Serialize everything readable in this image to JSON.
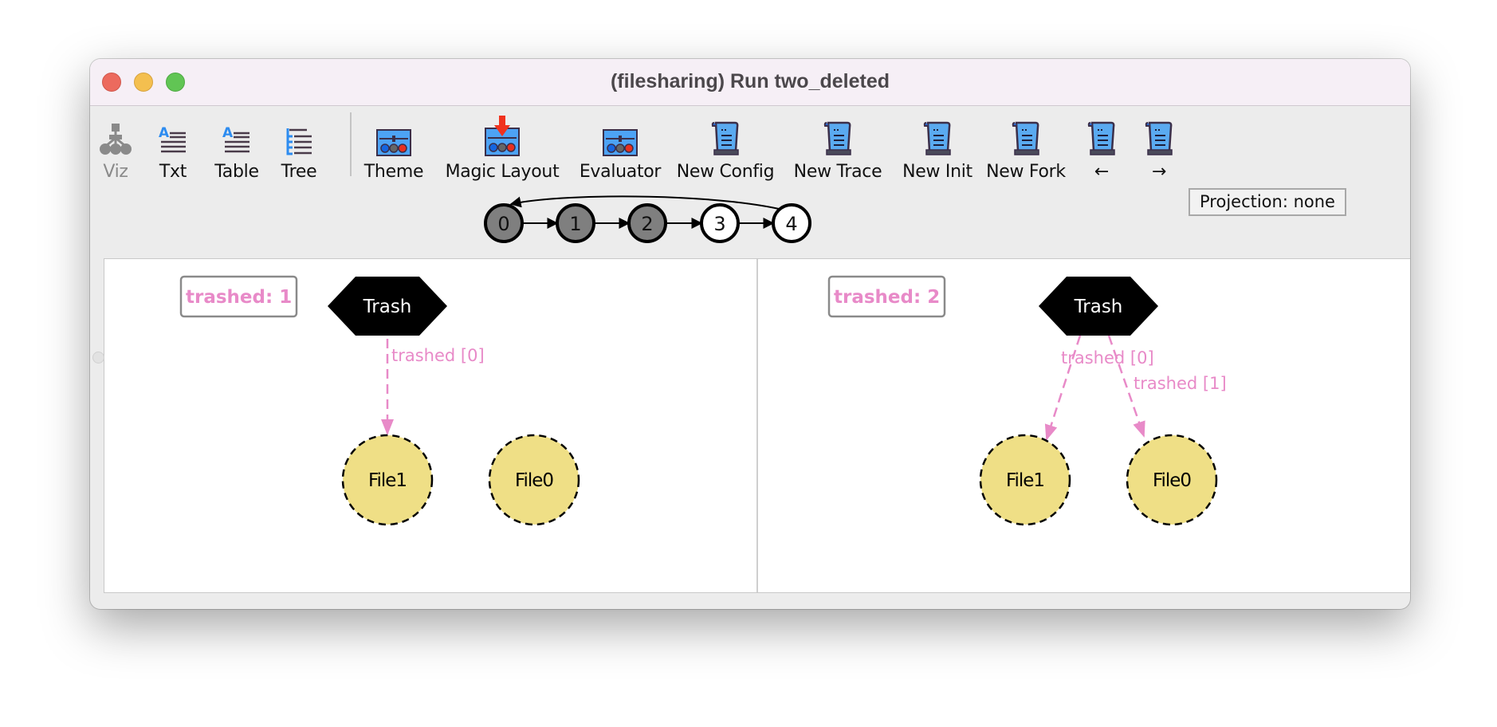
{
  "window": {
    "title": "(filesharing) Run two_deleted"
  },
  "toolbar": {
    "items": [
      {
        "label": "Viz",
        "icon": "viz-tree-icon",
        "enabled": false
      },
      {
        "label": "Txt",
        "icon": "text-icon",
        "enabled": true
      },
      {
        "label": "Table",
        "icon": "table-icon",
        "enabled": true
      },
      {
        "label": "Tree",
        "icon": "tree-list-icon",
        "enabled": true
      },
      {
        "label": "Theme",
        "icon": "theme-icon",
        "enabled": true
      },
      {
        "label": "Magic Layout",
        "icon": "magic-layout-icon",
        "enabled": true
      },
      {
        "label": "Evaluator",
        "icon": "evaluator-icon",
        "enabled": true
      },
      {
        "label": "New Config",
        "icon": "scroll-icon",
        "enabled": true
      },
      {
        "label": "New Trace",
        "icon": "scroll-icon",
        "enabled": true
      },
      {
        "label": "New Init",
        "icon": "scroll-icon",
        "enabled": true
      },
      {
        "label": "New Fork",
        "icon": "scroll-icon",
        "enabled": true
      },
      {
        "label": "←",
        "icon": "scroll-icon",
        "enabled": true
      },
      {
        "label": "→",
        "icon": "scroll-icon",
        "enabled": true
      }
    ],
    "projection_label": "Projection: none"
  },
  "trace": {
    "states": [
      {
        "label": "0",
        "visited": true
      },
      {
        "label": "1",
        "visited": true
      },
      {
        "label": "2",
        "visited": true
      },
      {
        "label": "3",
        "visited": false
      },
      {
        "label": "4",
        "visited": false
      }
    ],
    "loop_back_to": "0"
  },
  "panels": [
    {
      "counter": "trashed: 1",
      "trash_label": "Trash",
      "files": [
        {
          "label": "File1"
        },
        {
          "label": "File0"
        }
      ],
      "edges": [
        {
          "label": "trashed [0]",
          "to": "File1"
        }
      ]
    },
    {
      "counter": "trashed: 2",
      "trash_label": "Trash",
      "files": [
        {
          "label": "File1"
        },
        {
          "label": "File0"
        }
      ],
      "edges": [
        {
          "label": "trashed [0]",
          "to": "File1"
        },
        {
          "label": "trashed [1]",
          "to": "File0"
        }
      ]
    }
  ],
  "colors": {
    "edge_pink": "#e88ac8",
    "file_fill": "#efdf86",
    "visited_state": "#7f7f7f",
    "trash_fill": "#000000"
  }
}
